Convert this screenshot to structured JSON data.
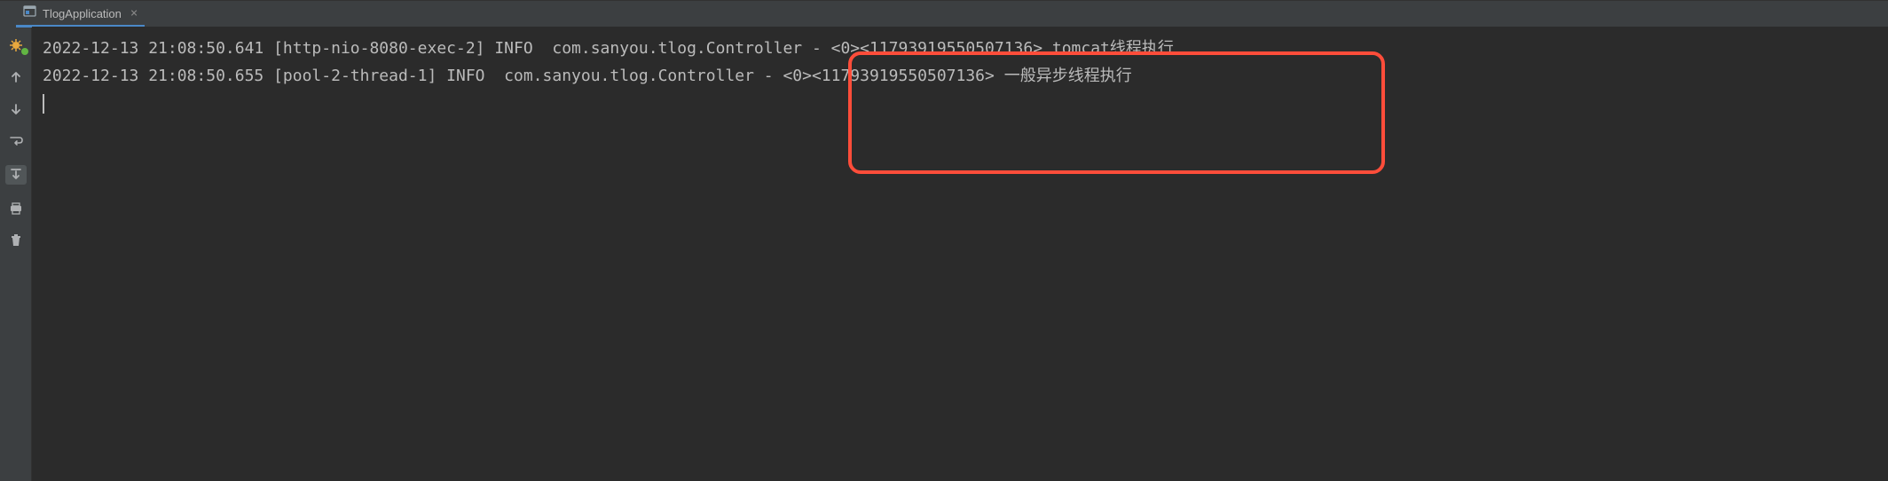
{
  "tab": {
    "label": "TlogApplication",
    "close_glyph": "×"
  },
  "console": {
    "lines": [
      "2022-12-13 21:08:50.641 [http-nio-8080-exec-2] INFO  com.sanyou.tlog.Controller - <0><11793919550507136> tomcat线程执行",
      "2022-12-13 21:08:50.655 [pool-2-thread-1] INFO  com.sanyou.tlog.Controller - <0><11793919550507136> 一般异步线程执行"
    ]
  },
  "highlight": {
    "top": "28",
    "left": "920",
    "width": "605",
    "height": "138"
  }
}
